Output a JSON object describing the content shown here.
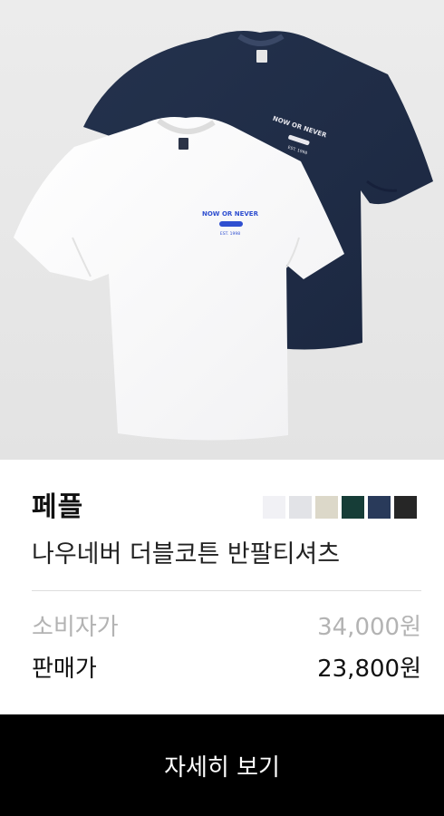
{
  "product": {
    "brand": "페플",
    "name": "나우네버 더블코튼 반팔티셔츠",
    "colors": [
      "#f1f1f5",
      "#e2e3e7",
      "#dcd8c9",
      "#163d37",
      "#293a5a",
      "#262626"
    ],
    "graphic": {
      "line1": "NOW OR NEVER",
      "line2": "EST. 1998"
    }
  },
  "pricing": {
    "retail_label": "소비자가",
    "retail_price": "34,000원",
    "sale_label": "판매가",
    "sale_price": "23,800원"
  },
  "actions": {
    "detail_label": "자세히 보기"
  }
}
